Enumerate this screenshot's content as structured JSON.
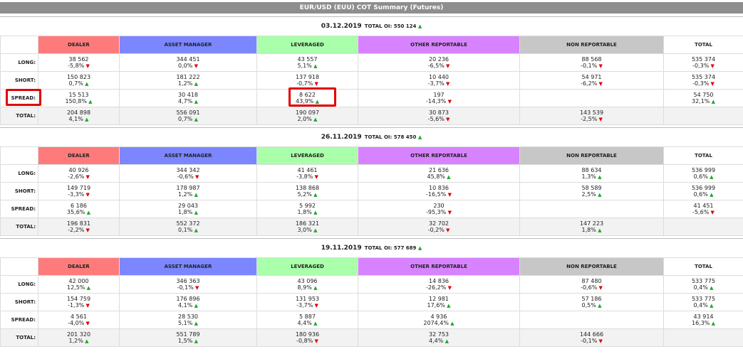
{
  "title": "EUR/USD (EUU) COT Summary (Futures)",
  "columns": [
    "DEALER",
    "ASSET MANAGER",
    "LEVERAGED",
    "OTHER REPORTABLE",
    "NON REPORTABLE",
    "TOTAL"
  ],
  "row_labels": [
    "LONG:",
    "SHORT:",
    "SPREAD:",
    "TOTAL:"
  ],
  "oi_label": "TOTAL OI:",
  "blocks": [
    {
      "date": "03.12.2019",
      "total_oi": "550 124",
      "total_oi_dir": "up",
      "rows": [
        [
          [
            "38 562",
            "-5,8%",
            "down"
          ],
          [
            "344 451",
            "0,0%",
            "down"
          ],
          [
            "43 557",
            "5,1%",
            "up"
          ],
          [
            "20 236",
            "-6,5%",
            "down"
          ],
          [
            "88 568",
            "-0,1%",
            "down"
          ],
          [
            "535 374",
            "-0,3%",
            "down"
          ]
        ],
        [
          [
            "150 823",
            "0,7%",
            "up"
          ],
          [
            "181 222",
            "1,2%",
            "up"
          ],
          [
            "137 918",
            "-0,7%",
            "down"
          ],
          [
            "10 440",
            "-3,7%",
            "down"
          ],
          [
            "54 971",
            "-6,2%",
            "down"
          ],
          [
            "535 374",
            "-0,3%",
            "down"
          ]
        ],
        [
          [
            "15 513",
            "150,8%",
            "up"
          ],
          [
            "30 418",
            "4,7%",
            "up"
          ],
          [
            "8 622",
            "43,9%",
            "up"
          ],
          [
            "197",
            "-14,3%",
            "down"
          ],
          [
            "",
            "",
            " "
          ],
          [
            "54 750",
            "32,1%",
            "up"
          ]
        ],
        [
          [
            "204 898",
            "4,1%",
            "up"
          ],
          [
            "556 091",
            "0,7%",
            "up"
          ],
          [
            "190 097",
            "2,0%",
            "up"
          ],
          [
            "30 873",
            "-5,6%",
            "down"
          ],
          [
            "143 539",
            "-2,5%",
            "down"
          ],
          [
            "",
            "",
            ""
          ]
        ]
      ]
    },
    {
      "date": "26.11.2019",
      "total_oi": "578 450",
      "total_oi_dir": "up",
      "rows": [
        [
          [
            "40 926",
            "-2,6%",
            "down"
          ],
          [
            "344 342",
            "-0,6%",
            "down"
          ],
          [
            "41 461",
            "-3,8%",
            "down"
          ],
          [
            "21 636",
            "45,8%",
            "up"
          ],
          [
            "88 634",
            "1,3%",
            "up"
          ],
          [
            "536 999",
            "0,6%",
            "up"
          ]
        ],
        [
          [
            "149 719",
            "-3,3%",
            "down"
          ],
          [
            "178 987",
            "1,2%",
            "up"
          ],
          [
            "138 868",
            "5,2%",
            "up"
          ],
          [
            "10 836",
            "-16,5%",
            "down"
          ],
          [
            "58 589",
            "2,5%",
            "up"
          ],
          [
            "536 999",
            "0,6%",
            "up"
          ]
        ],
        [
          [
            "6 186",
            "35,6%",
            "up"
          ],
          [
            "29 043",
            "1,8%",
            "up"
          ],
          [
            "5 992",
            "1,8%",
            "up"
          ],
          [
            "230",
            "-95,3%",
            "down"
          ],
          [
            "",
            "",
            ""
          ],
          [
            "41 451",
            "-5,6%",
            "down"
          ]
        ],
        [
          [
            "196 831",
            "-2,2%",
            "down"
          ],
          [
            "552 372",
            "0,1%",
            "up"
          ],
          [
            "186 321",
            "3,0%",
            "up"
          ],
          [
            "32 702",
            "-0,2%",
            "down"
          ],
          [
            "147 223",
            "1,8%",
            "up"
          ],
          [
            "",
            "",
            ""
          ]
        ]
      ]
    },
    {
      "date": "19.11.2019",
      "total_oi": "577 689",
      "total_oi_dir": "up",
      "rows": [
        [
          [
            "42 000",
            "12,5%",
            "up"
          ],
          [
            "346 363",
            "-0,1%",
            "down"
          ],
          [
            "43 096",
            "8,9%",
            "up"
          ],
          [
            "14 836",
            "-26,2%",
            "down"
          ],
          [
            "87 480",
            "-0,6%",
            "down"
          ],
          [
            "533 775",
            "0,4%",
            "up"
          ]
        ],
        [
          [
            "154 759",
            "-1,3%",
            "down"
          ],
          [
            "176 896",
            "4,1%",
            "up"
          ],
          [
            "131 953",
            "-3,7%",
            "down"
          ],
          [
            "12 981",
            "17,6%",
            "up"
          ],
          [
            "57 186",
            "0,5%",
            "up"
          ],
          [
            "533 775",
            "0,4%",
            "up"
          ]
        ],
        [
          [
            "4 561",
            "-4,0%",
            "down"
          ],
          [
            "28 530",
            "5,1%",
            "up"
          ],
          [
            "5 887",
            "4,4%",
            "up"
          ],
          [
            "4 936",
            "2074,4%",
            "up"
          ],
          [
            "",
            "",
            ""
          ],
          [
            "43 914",
            "16,3%",
            "up"
          ]
        ],
        [
          [
            "201 320",
            "1,2%",
            "up"
          ],
          [
            "551 789",
            "1,5%",
            "up"
          ],
          [
            "180 936",
            "-0,8%",
            "down"
          ],
          [
            "32 753",
            "4,4%",
            "up"
          ],
          [
            "144 666",
            "-0,1%",
            "down"
          ],
          [
            "",
            "",
            ""
          ]
        ]
      ]
    }
  ]
}
